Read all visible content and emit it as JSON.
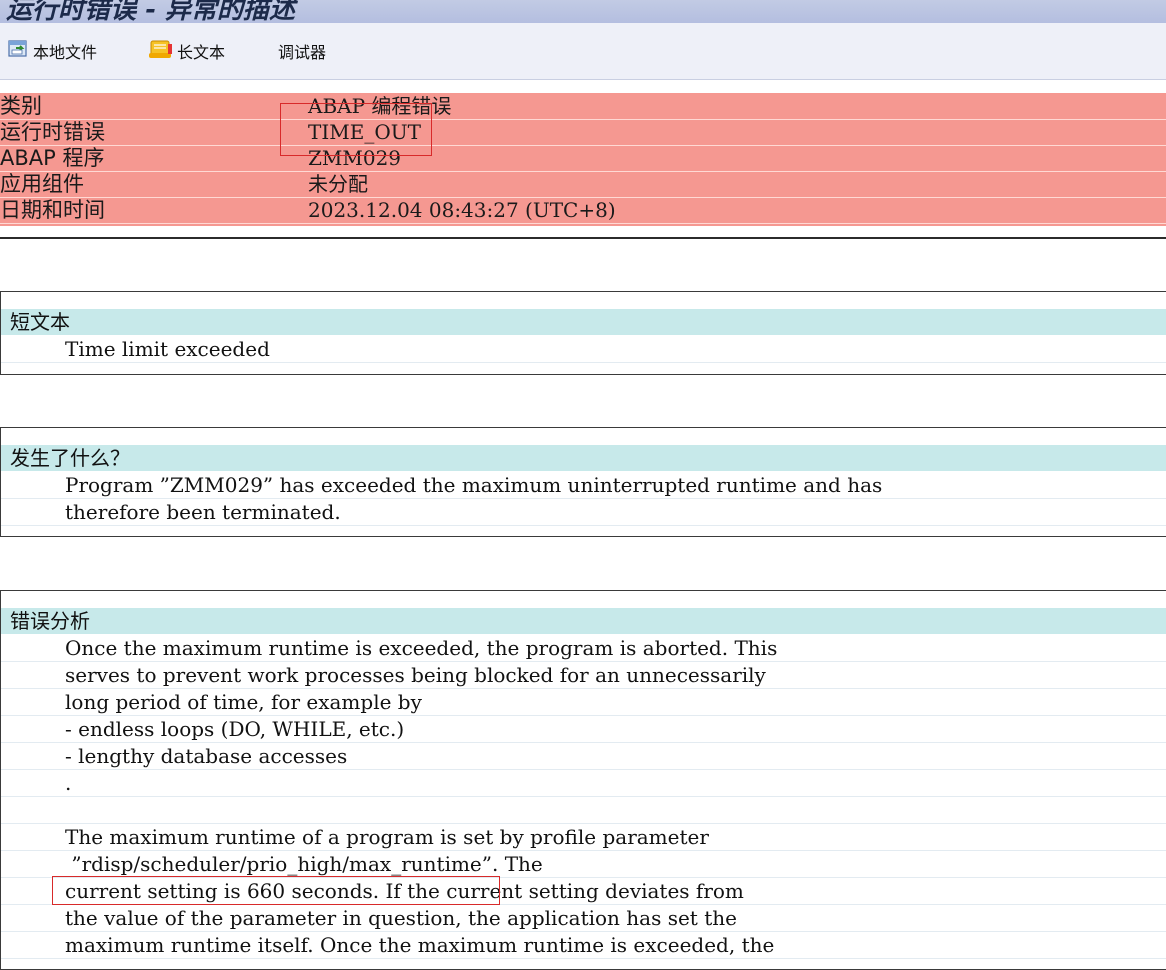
{
  "window": {
    "title": "运行时错误 - 异常的描述"
  },
  "toolbar": {
    "local_file": "本地文件",
    "long_text": "长文本",
    "debugger": "调试器"
  },
  "header": {
    "rows": [
      {
        "label": "类别",
        "value": "ABAP 编程错误"
      },
      {
        "label": "运行时错误",
        "value": "TIME_OUT"
      },
      {
        "label": "ABAP 程序",
        "value": "ZMM029"
      },
      {
        "label": "应用组件",
        "value": "未分配"
      },
      {
        "label": "日期和时间",
        "value": "2023.12.04 08:43:27 (UTC+8)"
      }
    ]
  },
  "short_text": {
    "heading": "短文本",
    "lines": [
      "Time limit exceeded"
    ]
  },
  "what_happened": {
    "heading": "发生了什么？",
    "lines": [
      "Program ”ZMM029” has exceeded the maximum uninterrupted runtime and has",
      "therefore been terminated."
    ]
  },
  "error_analysis": {
    "heading": "错误分析",
    "lines": [
      "Once the maximum runtime is exceeded, the program is aborted. This",
      "serves to prevent work processes being blocked for an unnecessarily",
      "long period of time, for example by",
      "- endless loops (DO, WHILE, etc.)",
      "- lengthy database accesses",
      ".",
      "",
      "The maximum runtime of a program is set by profile parameter",
      " ”rdisp/scheduler/prio_high/max_runtime”. The",
      "current setting is 660 seconds. If the current setting deviates from",
      "the value of the parameter in question, the application has set the",
      "maximum runtime itself. Once the maximum runtime is exceeded, the"
    ]
  },
  "colors": {
    "header_bg": "#f59891",
    "section_heading_bg": "#c7e9ea",
    "highlight_box": "#d82a2a"
  }
}
